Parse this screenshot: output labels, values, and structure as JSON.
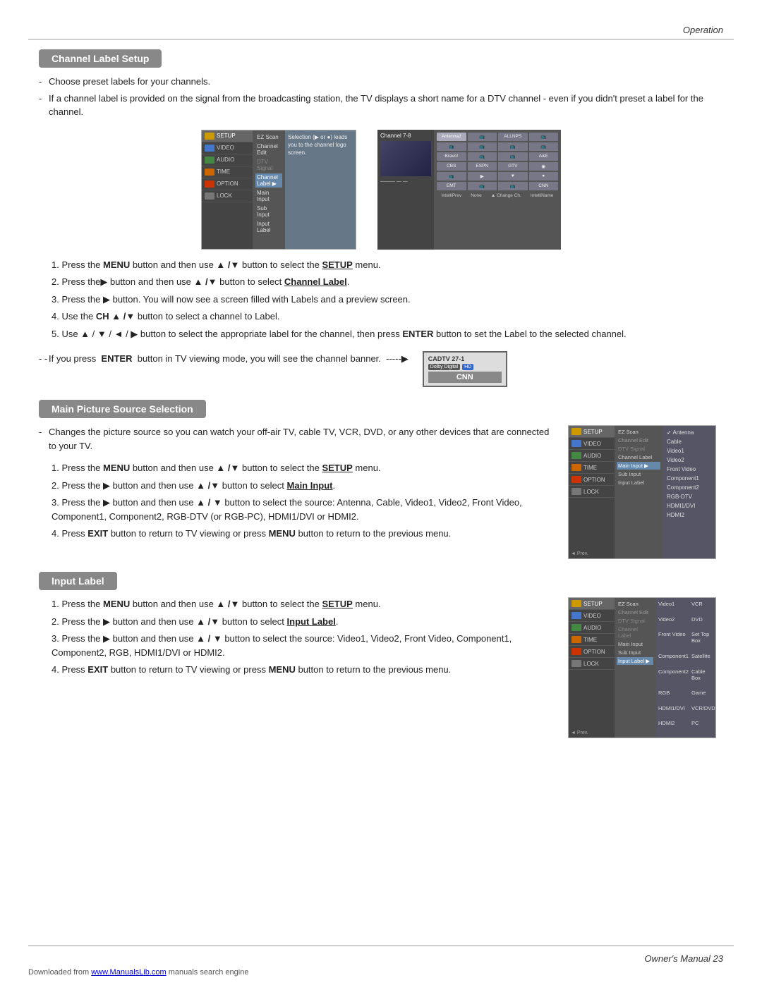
{
  "header": {
    "label": "Operation"
  },
  "footer": {
    "text": "Owner's Manual  23",
    "download": "Downloaded from",
    "download_link": "www.ManualsLib.com",
    "download_suffix": " manuals search engine"
  },
  "channel_label_setup": {
    "title": "Channel Label Setup",
    "bullets": [
      "Choose preset labels for your channels.",
      "If a channel label is provided on the signal from the broadcasting station, the TV displays a short name for a DTV channel - even if you didn't preset a label for the channel."
    ],
    "steps": [
      {
        "num": "1.",
        "text_parts": [
          "Press the ",
          "MENU",
          " button and then use ",
          "▲ /▼",
          " button to select the ",
          "SETUP",
          " menu."
        ]
      },
      {
        "num": "2.",
        "text_parts": [
          "Press the ▶ button and then use ",
          "▲ /▼",
          " button to select ",
          "Channel Label",
          "."
        ]
      },
      {
        "num": "3.",
        "text_parts": [
          "Press the ▶ button. You will now see a screen filled with Labels and a preview screen."
        ]
      },
      {
        "num": "4.",
        "text_parts": [
          "Use the ",
          "CH ▲ /▼",
          " button to select a channel to Label."
        ]
      },
      {
        "num": "5.",
        "text_parts": [
          "Use ▲ / ▼ / ◄ / ▶ button to select the appropriate label for the channel, then press ",
          "ENTER",
          " button to set the Label to the selected channel."
        ]
      }
    ],
    "note": "If you press  ENTER   button in TV viewing mode, you will see the channel banner.",
    "channel_banner": {
      "top": "CADTV 27-1",
      "dolby": "Dolby Digital",
      "hd": "HD",
      "name": "CNN"
    }
  },
  "main_picture": {
    "title": "Main Picture Source Selection",
    "bullets": [
      "Changes the picture source so you can watch your off-air TV, cable TV, VCR, DVD, or any other devices that are connected to your TV."
    ],
    "steps": [
      {
        "num": "1.",
        "text_parts": [
          "Press the ",
          "MENU",
          " button and then use ",
          "▲ /▼",
          " button to select the ",
          "SETUP",
          " menu."
        ]
      },
      {
        "num": "2.",
        "text_parts": [
          "Press the ▶ button and then use ",
          "▲ /▼",
          " button to select ",
          "Main Input",
          "."
        ]
      },
      {
        "num": "3.",
        "text_parts": [
          "Press the ▶ button and then use ",
          "▲ / ▼",
          " button to select the source: Antenna, Cable, Video1, Video2, Front Video, Component1, Component2, RGB-DTV (or RGB-PC), HDMI1/DVI or HDMI2."
        ]
      },
      {
        "num": "4.",
        "text_parts": [
          "Press ",
          "EXIT",
          " button to return to TV viewing or press ",
          "MENU",
          " button to return to the previous menu."
        ]
      }
    ],
    "menu_items": [
      "✓ Antenna",
      "Cable",
      "Video1",
      "Video2",
      "Front Video",
      "Component1",
      "Component2",
      "RGB-DTV",
      "HDMI1/DVI",
      "HDMI2"
    ]
  },
  "input_label": {
    "title": "Input Label",
    "steps": [
      {
        "num": "1.",
        "text_parts": [
          "Press the ",
          "MENU",
          " button and then use ",
          "▲ /▼",
          " button to select the ",
          "SETUP",
          " menu."
        ]
      },
      {
        "num": "2.",
        "text_parts": [
          "Press the ▶ button and then use ",
          "▲ /▼",
          " button to select ",
          "Input Label",
          "."
        ]
      },
      {
        "num": "3.",
        "text_parts": [
          "Press the ▶ button and then use ",
          "▲ / ▼",
          " button to select the source: Video1, Video2, Front Video, Component1, Component2, RGB, HDMI1/DVI or HDMI2."
        ]
      },
      {
        "num": "4.",
        "text_parts": [
          "Press ",
          "EXIT",
          " button to return to TV viewing or press ",
          "MENU",
          " button to return to the previous menu."
        ]
      }
    ],
    "menu_right": [
      {
        "label": "Video1",
        "value": "VCR"
      },
      {
        "label": "Video2",
        "value": "DVD"
      },
      {
        "label": "Front Video",
        "value": "Set Top Box"
      },
      {
        "label": "Component1",
        "value": "Satellite"
      },
      {
        "label": "Component2",
        "value": "Cable Box"
      },
      {
        "label": "RGB",
        "value": "Game"
      },
      {
        "label": "HDMI1/DVI",
        "value": "VCR/DVD"
      },
      {
        "label": "HDMI2",
        "value": "PC"
      }
    ]
  },
  "sidebar": {
    "items": [
      "SETUP",
      "VIDEO",
      "AUDIO",
      "TIME",
      "OPTION",
      "LOCK"
    ]
  },
  "setup_menu_items": [
    "EZ Scan",
    "Channel Edit",
    "DTV Signal",
    "Channel Label",
    "Main Input",
    "Sub Input",
    "Input Label"
  ],
  "prev_label": "Prev."
}
